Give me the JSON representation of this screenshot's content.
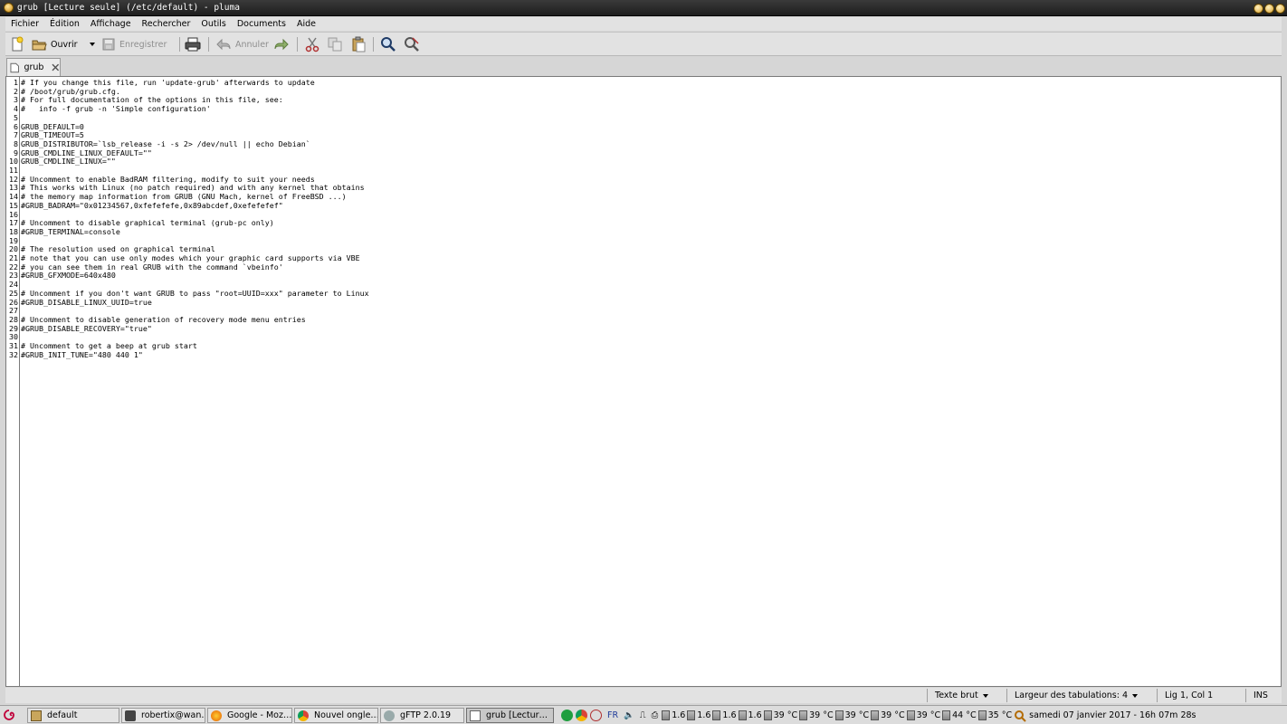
{
  "window": {
    "title": "grub [Lecture seule] (/etc/default) - pluma"
  },
  "menu": [
    "Fichier",
    "Édition",
    "Affichage",
    "Rechercher",
    "Outils",
    "Documents",
    "Aide"
  ],
  "toolbar": {
    "open_label": "Ouvrir",
    "save_label": "Enregistrer",
    "undo_label": "Annuler"
  },
  "tab": {
    "label": "grub"
  },
  "editor": {
    "lines": [
      "# If you change this file, run 'update-grub' afterwards to update",
      "# /boot/grub/grub.cfg.",
      "# For full documentation of the options in this file, see:",
      "#   info -f grub -n 'Simple configuration'",
      "",
      "GRUB_DEFAULT=0",
      "GRUB_TIMEOUT=5",
      "GRUB_DISTRIBUTOR=`lsb_release -i -s 2> /dev/null || echo Debian`",
      "GRUB_CMDLINE_LINUX_DEFAULT=\"\"",
      "GRUB_CMDLINE_LINUX=\"\"",
      "",
      "# Uncomment to enable BadRAM filtering, modify to suit your needs",
      "# This works with Linux (no patch required) and with any kernel that obtains",
      "# the memory map information from GRUB (GNU Mach, kernel of FreeBSD ...)",
      "#GRUB_BADRAM=\"0x01234567,0xfefefefe,0x89abcdef,0xefefefef\"",
      "",
      "# Uncomment to disable graphical terminal (grub-pc only)",
      "#GRUB_TERMINAL=console",
      "",
      "# The resolution used on graphical terminal",
      "# note that you can use only modes which your graphic card supports via VBE",
      "# you can see them in real GRUB with the command `vbeinfo'",
      "#GRUB_GFXMODE=640x480",
      "",
      "# Uncomment if you don't want GRUB to pass \"root=UUID=xxx\" parameter to Linux",
      "#GRUB_DISABLE_LINUX_UUID=true",
      "",
      "# Uncomment to disable generation of recovery mode menu entries",
      "#GRUB_DISABLE_RECOVERY=\"true\"",
      "",
      "# Uncomment to get a beep at grub start",
      "#GRUB_INIT_TUNE=\"480 440 1\""
    ]
  },
  "statusbar": {
    "mode": "Texte brut",
    "tab_width": "Largeur des tabulations:  4",
    "position": "Lig 1, Col 1",
    "insert_mode": "INS"
  },
  "taskbar": {
    "tasks": [
      {
        "label": "default",
        "icon": "folder-icon"
      },
      {
        "label": "robertix@wan…",
        "icon": "terminal-icon"
      },
      {
        "label": "Google - Moz…",
        "icon": "firefox-icon"
      },
      {
        "label": "Nouvel ongle…",
        "icon": "chrome-icon"
      },
      {
        "label": "gFTP 2.0.19",
        "icon": "gftp-icon"
      },
      {
        "label": "grub [Lectur…",
        "icon": "text-editor-icon"
      }
    ],
    "keyboard_layout": "FR",
    "cpu_freqs": [
      "1.6",
      "1.6",
      "1.6",
      "1.6"
    ],
    "temps": [
      "39 °C",
      "39 °C",
      "39 °C",
      "39 °C",
      "39 °C",
      "44 °C",
      "35 °C"
    ],
    "clock": "samedi 07 janvier 2017 - 16h 07m 28s"
  }
}
